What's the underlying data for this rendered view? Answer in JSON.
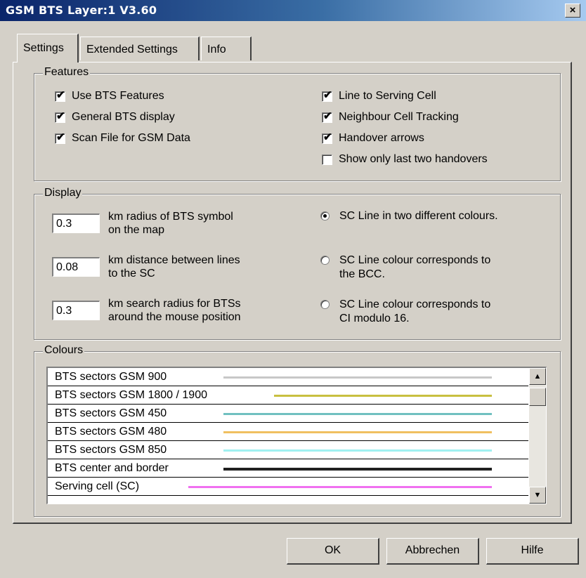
{
  "window": {
    "title": "GSM BTS Layer:1 V3.60",
    "close_glyph": "×"
  },
  "tabs": [
    {
      "label": "Settings",
      "active": true
    },
    {
      "label": "Extended Settings",
      "active": false
    },
    {
      "label": "Info",
      "active": false
    }
  ],
  "features": {
    "title": "Features",
    "left": [
      {
        "label": "Use BTS Features",
        "checked": true
      },
      {
        "label": "General BTS display",
        "checked": true
      },
      {
        "label": "Scan File for GSM Data",
        "checked": true
      }
    ],
    "right": [
      {
        "label": "Line to Serving Cell",
        "checked": true
      },
      {
        "label": "Neighbour Cell Tracking",
        "checked": true
      },
      {
        "label": "Handover arrows",
        "checked": true
      },
      {
        "label": "Show only last two handovers",
        "checked": false
      }
    ]
  },
  "display": {
    "title": "Display",
    "fields": [
      {
        "value": "0.3",
        "line1": "km  radius of BTS symbol",
        "line2": "on the map"
      },
      {
        "value": "0.08",
        "line1": "km  distance between lines",
        "line2": "to the SC"
      },
      {
        "value": "0.3",
        "line1": "km  search radius for BTSs",
        "line2": "around the mouse position"
      }
    ],
    "radios": [
      {
        "line1": "SC Line in two different colours.",
        "line2": "",
        "selected": true
      },
      {
        "line1": "SC Line colour corresponds to",
        "line2": "the BCC.",
        "selected": false
      },
      {
        "line1": "SC Line colour corresponds to",
        "line2": "CI modulo 16.",
        "selected": false
      }
    ]
  },
  "colours": {
    "title": "Colours",
    "items": [
      {
        "label": "BTS sectors GSM 900",
        "color": "#c8c8c8"
      },
      {
        "label": "BTS sectors GSM 1800 / 1900",
        "color": "#c8c040"
      },
      {
        "label": "BTS sectors GSM 450",
        "color": "#70c0c0"
      },
      {
        "label": "BTS sectors GSM 480",
        "color": "#f0c060"
      },
      {
        "label": "BTS sectors GSM 850",
        "color": "#a0f0f0"
      },
      {
        "label": "BTS center and border",
        "color": "#202020"
      },
      {
        "label": "Serving cell (SC)",
        "color": "#f070f0"
      }
    ]
  },
  "buttons": {
    "ok": "OK",
    "cancel": "Abbrechen",
    "help": "Hilfe"
  }
}
